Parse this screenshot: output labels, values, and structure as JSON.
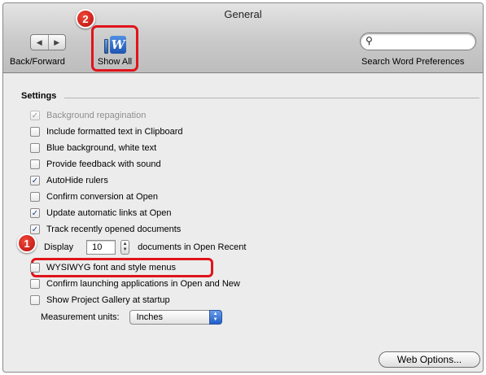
{
  "window": {
    "title": "General"
  },
  "toolbar": {
    "nav_label": "Back/Forward",
    "back_glyph": "◀",
    "forward_glyph": "▶",
    "show_all_label": "Show All",
    "show_all_icon": "word-preferences-icon",
    "show_all_icon_text": "W",
    "search_label": "Search Word Preferences",
    "search_placeholder": "",
    "search_icon_glyph": "⚲"
  },
  "annotations": {
    "badge1": "1",
    "badge2": "2",
    "highlight_color": "#e0141b"
  },
  "settings": {
    "heading": "Settings",
    "options": [
      {
        "label": "Background repagination",
        "checked": true,
        "disabled": true
      },
      {
        "label": "Include formatted text in Clipboard",
        "checked": false
      },
      {
        "label": "Blue background, white text",
        "checked": false
      },
      {
        "label": "Provide feedback with sound",
        "checked": false
      },
      {
        "label": "AutoHide rulers",
        "checked": true
      },
      {
        "label": "Confirm conversion at Open",
        "checked": false
      },
      {
        "label": "Update automatic links at Open",
        "checked": true
      },
      {
        "label": "Track recently opened documents",
        "checked": true
      }
    ],
    "display": {
      "prefix": "Display",
      "value": "10",
      "suffix": "documents in Open Recent"
    },
    "options2": [
      {
        "label": "WYSIWYG font and style menus",
        "checked": false
      },
      {
        "label": "Confirm launching applications in Open and New",
        "checked": false
      },
      {
        "label": "Show Project Gallery at startup",
        "checked": false
      }
    ],
    "units": {
      "label": "Measurement units:",
      "value": "Inches"
    }
  },
  "buttons": {
    "web_options": "Web Options..."
  },
  "glyphs": {
    "check": "✓",
    "up": "▲",
    "down": "▼"
  }
}
